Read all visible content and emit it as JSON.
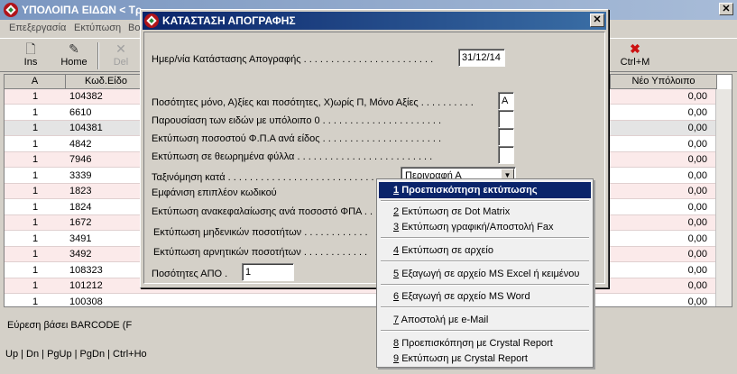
{
  "background": {
    "title": "ΥΠΟΛΟΙΠΑ ΕΙΔΩΝ < Τρ",
    "menu": [
      "Επεξεργασία",
      "Εκτύπωση",
      "Βο"
    ],
    "toolbar": {
      "ins": "Ins",
      "home": "Home",
      "del": "Del",
      "ctrlm": "Ctrl+M"
    },
    "table": {
      "headers": [
        "Α",
        "Κωδ.Είδο",
        "Νέο Υπόλοιπο"
      ],
      "rows": [
        {
          "a": "1",
          "code": "104382",
          "balance": "0,00"
        },
        {
          "a": "1",
          "code": "6610",
          "balance": "0,00"
        },
        {
          "a": "1",
          "code": "104381",
          "balance": "0,00"
        },
        {
          "a": "1",
          "code": "4842",
          "balance": "0,00"
        },
        {
          "a": "1",
          "code": "7946",
          "balance": "0,00"
        },
        {
          "a": "1",
          "code": "3339",
          "balance": "0,00"
        },
        {
          "a": "1",
          "code": "1823",
          "balance": "0,00"
        },
        {
          "a": "1",
          "code": "1824",
          "balance": "0,00"
        },
        {
          "a": "1",
          "code": "1672",
          "balance": "0,00"
        },
        {
          "a": "1",
          "code": "3491",
          "balance": "0,00"
        },
        {
          "a": "1",
          "code": "3492",
          "balance": "0,00"
        },
        {
          "a": "1",
          "code": "108323",
          "balance": "0,00"
        },
        {
          "a": "1",
          "code": "101212",
          "balance": "0,00"
        },
        {
          "a": "1",
          "code": "100308",
          "balance": "0,00"
        }
      ]
    },
    "barcode_text": "Εύρεση βάσει BARCODE (F",
    "keys_text": "Up | Dn | PgUp | PgDn | Ctrl+Ho"
  },
  "dialog": {
    "title": "ΚΑΤΑΣΤΑΣΗ ΑΠΟΓΡΑΦΗΣ",
    "close": "✕",
    "date_label": "Ημερ/νία Κατάστασης Απογραφής . . . . . . . . . . . . . . . . . . . . . . . .",
    "date_value": "31/12/14",
    "qty_label": "Ποσότητες μόνο, Α)ξίες και ποσότητες, Χ)ωρίς Π, Μόνο Αξίες . . . . . . . . . .",
    "qty_value": "Α",
    "zero_label": "Παρουσίαση των ειδών με υπόλοιπο 0 . . . . . . . . . . . . . . . . . . . . . .",
    "vat_label": "Εκτύπωση ποσοστού Φ.Π.Α ανά είδος . . . . . . . . . . . . . . . . . . . . . .",
    "sheets_label": "Εκτύπωση σε θεωρημένα φύλλα . . . . . . . . . . . . . . . . . . . . . . . . .",
    "sort_label": "Ταξινόμηση κατά . . . . . . . . . . . . . . . . . . . . . . . . . . . . . . . . .",
    "sort_value": "Περιγραφή Α",
    "extra_code_label": "Εμφάνιση επιπλέον κωδικού",
    "summary_label": "Εκτύπωση ανακεφαλαίωσης ανά ποσοστό ΦΠΑ . . .",
    "zero_qty_label": "Εκτύπωση μηδενικών ποσοτήτων . . . . . . . . . . . .",
    "neg_qty_label": "Εκτύπωση αρνητικών ποσοτήτων . . . . . . . . . . . .",
    "from_qty_label": "Ποσότητες   ΑΠΟ .",
    "from_qty_value": "1"
  },
  "popup": {
    "items": [
      {
        "num": "1",
        "label": "Προεπισκόπηση εκτύπωσης"
      },
      {
        "num": "2",
        "label": "Εκτύπωση σε Dot Matrix"
      },
      {
        "num": "3",
        "label": "Εκτύπωση γραφική/Αποστολή Fax"
      },
      {
        "num": "4",
        "label": "Εκτύπωση σε αρχείο"
      },
      {
        "num": "5",
        "label": "Εξαγωγή σε αρχείο MS Excel ή κειμένου"
      },
      {
        "num": "6",
        "label": "Εξαγωγή σε αρχείο MS Word"
      },
      {
        "num": "7",
        "label": "Αποστολή με e-Mail"
      },
      {
        "num": "8",
        "label": "Προεπισκόπηση με Crystal Report"
      },
      {
        "num": "9",
        "label": "Εκτύπωση με Crystal Report"
      }
    ]
  }
}
